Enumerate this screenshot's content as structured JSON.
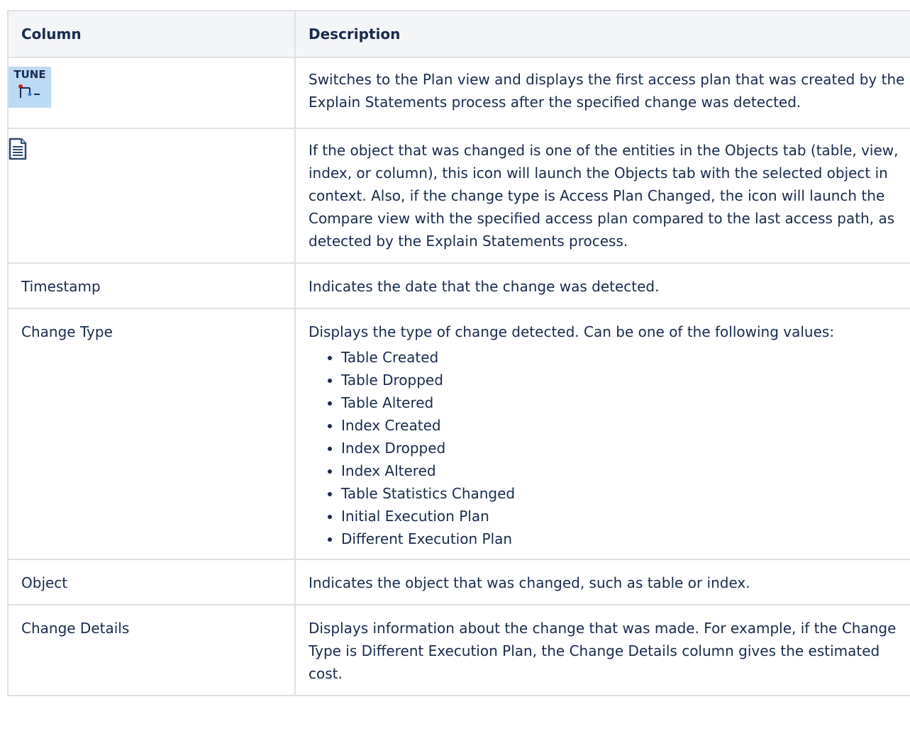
{
  "table": {
    "headers": [
      "Column",
      "Description"
    ],
    "rows": [
      {
        "column": "",
        "icon": "tune-icon",
        "icon_text": "TUNE",
        "description": "Switches to the Plan view and displays the first access plan that was created by the Explain Statements process after the specified change was detected."
      },
      {
        "column": "",
        "icon": "document-icon",
        "description": "If the object that was changed is one of the entities in the Objects tab (table, view, index, or column), this icon will launch the Objects tab with the selected object in context. Also, if the change type is Access Plan Changed, the icon will launch the Compare view with the specified access plan compared to the last access path, as detected by the Explain Statements process."
      },
      {
        "column": "Timestamp",
        "description": "Indicates the date that the change was detected."
      },
      {
        "column": "Change Type",
        "description": "Displays the type of change detected. Can be one of the following values:",
        "values": [
          "Table Created",
          "Table Dropped",
          "Table Altered",
          "Index Created",
          "Index Dropped",
          "Index Altered",
          "Table Statistics Changed",
          "Initial Execution Plan",
          "Different Execution Plan"
        ]
      },
      {
        "column": "Object",
        "description": "Indicates the object that was changed, such as table or index."
      },
      {
        "column": "Change Details",
        "description": "Displays information about the change that was made. For example, if the Change Type is Different Execution Plan, the Change Details column gives the estimated cost."
      }
    ]
  }
}
